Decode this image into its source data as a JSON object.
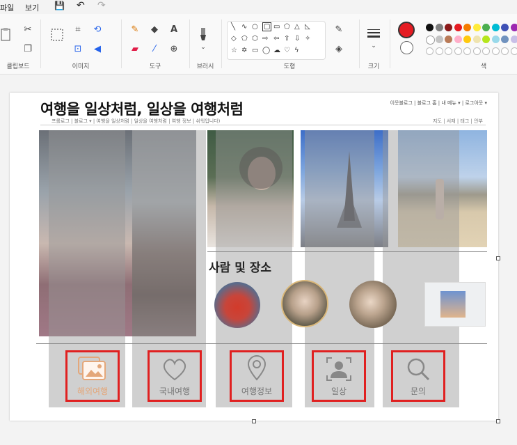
{
  "menubar": {
    "file": "파일",
    "view": "보기"
  },
  "ribbon": {
    "groups": {
      "clipboard": "클립보드",
      "image": "이미지",
      "tools": "도구",
      "brushes": "브러시",
      "shapes": "도형",
      "size": "크기",
      "colors": "색"
    },
    "colors": [
      "#111111",
      "#7f7f7f",
      "#8b1a1a",
      "#e51c23",
      "#f57c00",
      "#ffeb3b",
      "#4caf50",
      "#00bcd4",
      "#3f51b5",
      "#9c27b0"
    ],
    "colors_row2": [
      "#ffffff",
      "#c3c3c3",
      "#b97a57",
      "#ffaec9",
      "#ffc90e",
      "#efe4b0",
      "#b5e61d",
      "#99d9ea",
      "#7092be",
      "#c8bfe7"
    ],
    "primary_color": "#e51c23"
  },
  "blog": {
    "title": "여행을 일상처럼, 일상을 여행처럼",
    "top_links": "이웃블로그 | 블로그 홈 | 내 메뉴 ▾ | 로그아웃 ▾",
    "nav_left": "프롤로그 | 블로그 ▾ | 여행을 일상처럼 | 일상을 여행처럼 | 여행 정보 | 쉬워입니다)",
    "nav_right": "지도 | 서재 | 태그 | 안부",
    "section_title": "사람 및 장소"
  },
  "buttons": [
    {
      "label": "해외여행",
      "icon": "photos-icon"
    },
    {
      "label": "국내여행",
      "icon": "heart-icon"
    },
    {
      "label": "여행정보",
      "icon": "location-pin-icon"
    },
    {
      "label": "일상",
      "icon": "person-frame-icon"
    },
    {
      "label": "문의",
      "icon": "search-icon"
    }
  ]
}
